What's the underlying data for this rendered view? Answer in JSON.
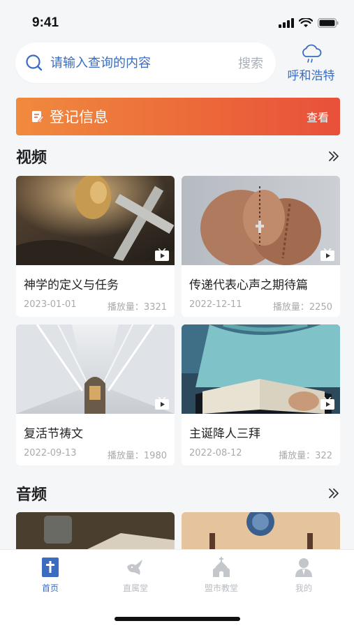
{
  "status_bar": {
    "time": "9:41"
  },
  "search": {
    "placeholder": "请输入查询的内容",
    "button_label": "搜索"
  },
  "weather": {
    "city": "呼和浩特",
    "icon": "cloud-rain-icon"
  },
  "register": {
    "title": "登记信息",
    "action": "查看"
  },
  "sections": {
    "video": "视频",
    "audio": "音频"
  },
  "videos": [
    {
      "title": "神学的定义与任务",
      "date": "2023-01-01",
      "plays": "播放量：3321"
    },
    {
      "title": "传递代表心声之期待篇",
      "date": "2022-12-11",
      "plays": "播放量：2250"
    },
    {
      "title": "复活节祷文",
      "date": "2022-09-13",
      "plays": "播放量：1980"
    },
    {
      "title": "主诞降人三拜",
      "date": "2022-08-12",
      "plays": "播放量：322"
    }
  ],
  "tabs": [
    {
      "label": "首页",
      "icon": "bible-icon",
      "active": true
    },
    {
      "label": "直属堂",
      "icon": "dove-icon",
      "active": false
    },
    {
      "label": "盟市教堂",
      "icon": "church-icon",
      "active": false
    },
    {
      "label": "我的",
      "icon": "user-icon",
      "active": false
    }
  ],
  "colors": {
    "accent": "#3a6cbf",
    "banner_start": "#f08a3e",
    "banner_end": "#e8503a",
    "background": "#f5f6f8"
  }
}
